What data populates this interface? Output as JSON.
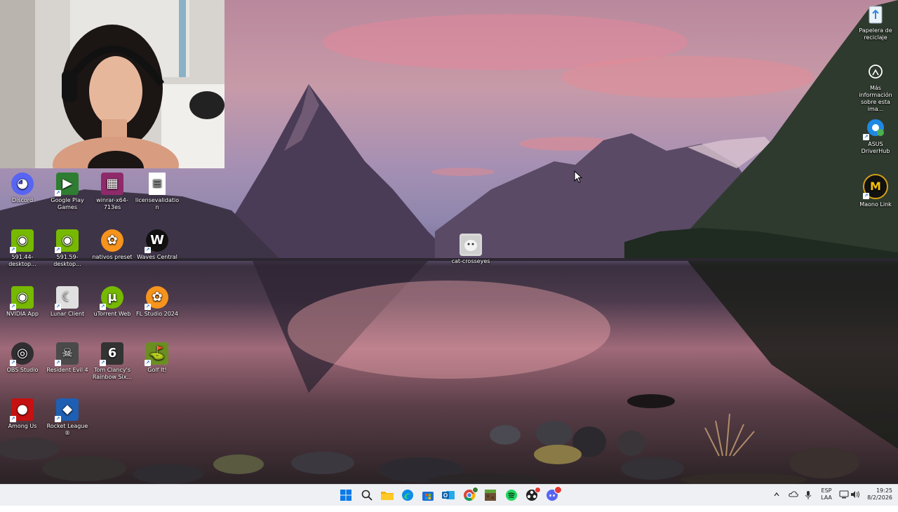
{
  "desktop": {
    "left_icons": [
      {
        "label": "Discord",
        "icon": "discord-icon",
        "color": "#5865F2"
      },
      {
        "label": "Google Play Games",
        "icon": "google-play-games-icon",
        "color": "#2e7d32"
      },
      {
        "label": "winrar-x64-713es",
        "icon": "winrar-icon",
        "color": "#8e2a6a"
      },
      {
        "label": "licensevalidation",
        "icon": "text-file-icon",
        "color": "#ffffff"
      },
      {
        "label": "591.44-desktop...",
        "icon": "nvidia-installer-icon",
        "color": "#76b900"
      },
      {
        "label": "591.59-desktop...",
        "icon": "nvidia-installer-icon",
        "color": "#76b900"
      },
      {
        "label": "nativos preset",
        "icon": "fl-studio-preset-icon",
        "color": "#f7941d"
      },
      {
        "label": "Waves Central",
        "icon": "waves-icon",
        "color": "#111111"
      },
      {
        "label": "NVIDIA App",
        "icon": "nvidia-icon",
        "color": "#76b900"
      },
      {
        "label": "Lunar Client",
        "icon": "lunar-client-icon",
        "color": "#e0e0e0"
      },
      {
        "label": "uTorrent Web",
        "icon": "utorrent-icon",
        "color": "#76b900"
      },
      {
        "label": "FL Studio 2024",
        "icon": "fl-studio-icon",
        "color": "#f7941d"
      },
      {
        "label": "OBS Studio",
        "icon": "obs-icon",
        "color": "#302e31"
      },
      {
        "label": "Resident Evil 4",
        "icon": "resident-evil-icon",
        "color": "#4a4a4a"
      },
      {
        "label": "Tom Clancy's Rainbow Six...",
        "icon": "rainbow-six-icon",
        "color": "#333333"
      },
      {
        "label": "Golf It!",
        "icon": "golf-it-icon",
        "color": "#6b8e23"
      },
      {
        "label": "Among Us",
        "icon": "among-us-icon",
        "color": "#c51111"
      },
      {
        "label": "Rocket League ®",
        "icon": "rocket-league-icon",
        "color": "#1e5fb4"
      }
    ],
    "center_icon": {
      "label": "cat-crosseyes",
      "icon": "image-file-icon"
    },
    "right_icons": [
      {
        "label": "Papelera de reciclaje",
        "icon": "recycle-bin-icon"
      },
      {
        "label": "Más información sobre esta ima...",
        "icon": "info-camera-icon"
      },
      {
        "label": "ASUS DriverHub",
        "icon": "asus-driverhub-icon"
      },
      {
        "label": "Maono Link",
        "icon": "maono-link-icon"
      }
    ]
  },
  "taskbar": {
    "apps": [
      "windows-start-icon",
      "search-icon",
      "file-explorer-icon",
      "edge-icon",
      "store-icon",
      "outlook-icon",
      "chrome-icon",
      "minecraft-icon",
      "spotify-icon",
      "obs-taskbar-icon",
      "discord-taskbar-icon"
    ],
    "tray": {
      "language_line1": "ESP",
      "language_line2": "LAA",
      "time": "19:25",
      "date": "8/2/2026"
    }
  }
}
